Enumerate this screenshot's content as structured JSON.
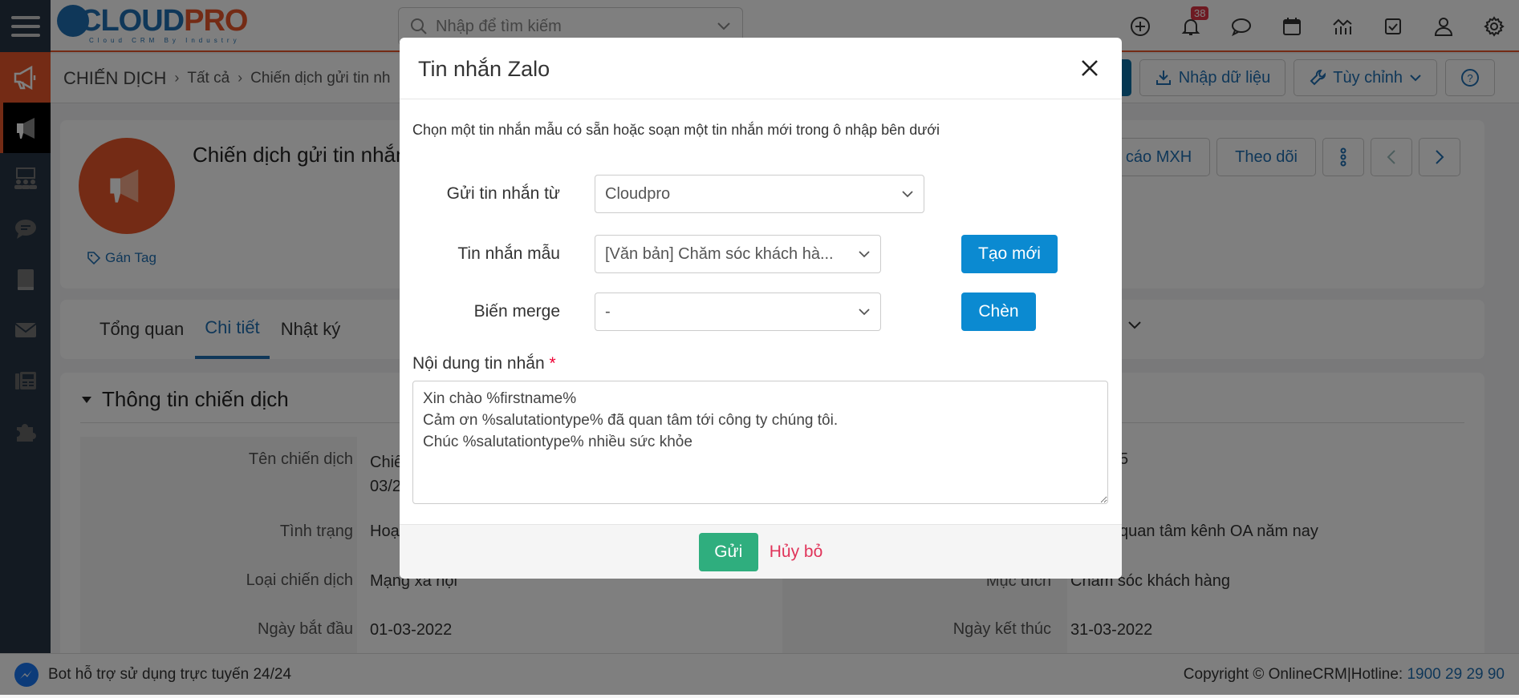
{
  "app": {
    "logo_main": "CLOUD",
    "logo_accent": "PRO",
    "logo_tagline": "Cloud CRM By Industry"
  },
  "topbar": {
    "search_placeholder": "Nhập để tìm kiếm",
    "notification_count": "38",
    "icons": [
      "plus-circle-icon",
      "bell-icon",
      "chat-icon",
      "calendar-icon",
      "analytics-icon",
      "task-check-icon",
      "user-icon",
      "gear-icon"
    ]
  },
  "sidebar": {
    "items": [
      "menu-icon",
      "megaphone-icon",
      "megaphone-active-icon",
      "team-icon",
      "chat-bubble-icon",
      "book-icon",
      "mail-icon",
      "fax-icon",
      "puzzle-icon"
    ]
  },
  "breadcrumb": {
    "module": "CHIẾN DỊCH",
    "all": "Tất cả",
    "current": "Chiến dịch gửi tin nh"
  },
  "crumb_actions": {
    "import_label": "Nhập dữ liệu",
    "customize_label": "Tùy chỉnh"
  },
  "record": {
    "title": "Chiến dịch gửi tin nhắn",
    "tag_label": "Gán Tag",
    "report_label": "Báo cáo MXH",
    "follow_label": "Theo dõi"
  },
  "tabs": [
    {
      "label": "Tổng quan",
      "active": false
    },
    {
      "label": "Chi tiết",
      "active": true
    },
    {
      "label": "Nhật ký",
      "active": false
    }
  ],
  "detail": {
    "section_title": "Thông tin chiến dịch",
    "left_fields": [
      {
        "label": "Tên chiến dịch",
        "value": "Chiế\n03/2"
      },
      {
        "label": "Tình trạng",
        "value": "Hoạ"
      },
      {
        "label": "Loại chiến dịch",
        "value": "Mạng xã hội"
      },
      {
        "label": "Ngày bắt đầu",
        "value": "01-03-2022"
      }
    ],
    "right_fields": [
      {
        "label": "",
        "value": "5"
      },
      {
        "label": "",
        "value": "quan tâm kênh OA năm nay"
      },
      {
        "label": "Mục đích",
        "value": "Chăm sóc khách hàng"
      },
      {
        "label": "Ngày kết thúc",
        "value": "31-03-2022"
      }
    ]
  },
  "footer": {
    "bot_text": "Bot hỗ trợ sử dụng trực tuyến 24/24",
    "copyright": "Copyright © OnlineCRM|Hotline: ",
    "hotline": "1900 29 29 90"
  },
  "modal": {
    "title": "Tin nhắn Zalo",
    "hint": "Chọn một tin nhắn mẫu có sẵn hoặc soạn một tin nhắn mới trong ô nhập bên dưới",
    "send_from_label": "Gửi tin nhắn từ",
    "send_from_value": "Cloudpro",
    "template_label": "Tin nhắn mẫu",
    "template_value": "[Văn bản] Chăm sóc khách hà...",
    "create_new_label": "Tạo mới",
    "merge_label": "Biến merge",
    "merge_value": "-",
    "insert_label": "Chèn",
    "content_label": "Nội dung tin nhắn",
    "required_mark": "*",
    "content_value": "Xin chào %firstname%\nCảm ơn %salutationtype% đã quan tâm tới công ty chúng tôi.\nChúc %salutationtype% nhiều sức khỏe",
    "send_label": "Gửi",
    "cancel_label": "Hủy bỏ"
  },
  "colors": {
    "brand_orange": "#e8572a",
    "brand_blue": "#1f6fb2",
    "primary_button": "#0b8ad1",
    "send_button": "#2fae7e",
    "cancel_link": "#e0345a"
  }
}
